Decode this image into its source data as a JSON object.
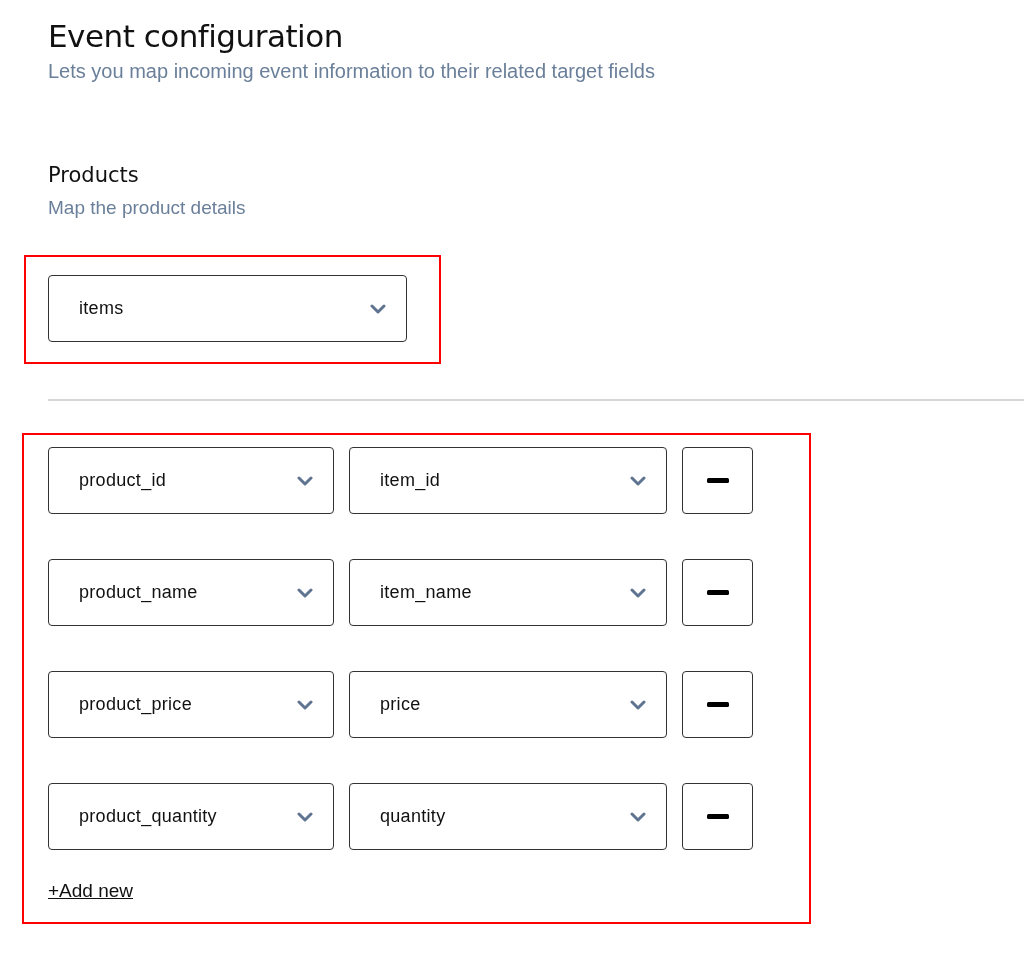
{
  "header": {
    "title": "Event configuration",
    "subtitle": "Lets you map incoming event information to their related target fields"
  },
  "products": {
    "title": "Products",
    "subtitle": "Map the product details",
    "source_select": {
      "value": "items"
    }
  },
  "mappings": [
    {
      "source": "product_id",
      "target": "item_id"
    },
    {
      "source": "product_name",
      "target": "item_name"
    },
    {
      "source": "product_price",
      "target": "price"
    },
    {
      "source": "product_quantity",
      "target": "quantity"
    }
  ],
  "add_link": "+Add new"
}
